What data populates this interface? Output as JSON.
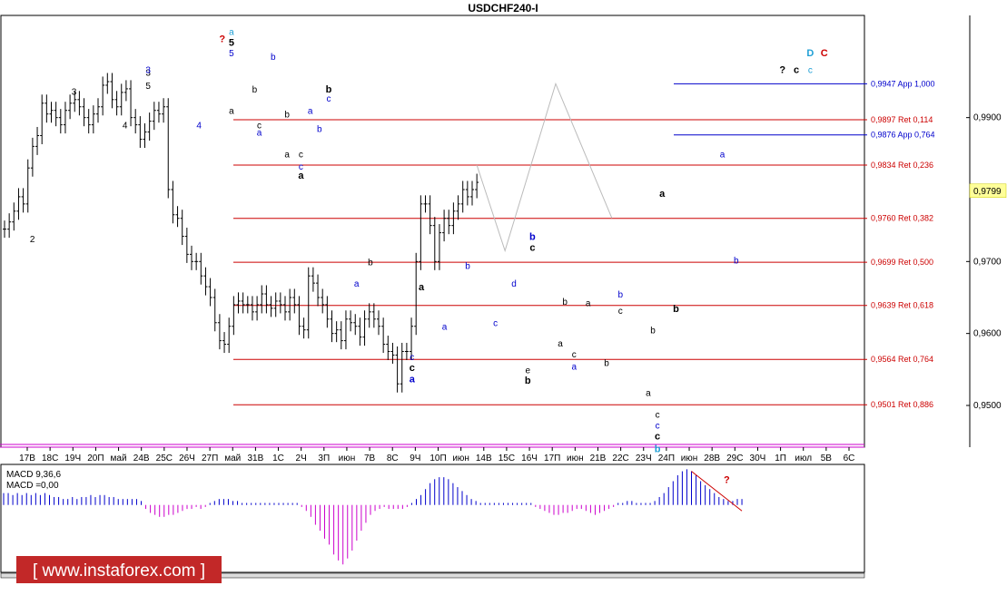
{
  "chart_data": {
    "type": "line",
    "title": "USDCHF240-I",
    "price_ylim": [
      0.9442,
      1.0042
    ],
    "y_ticks": [
      "0,9900",
      "0,9700",
      "0,9600",
      "0,9500"
    ],
    "x_ticks": [
      "17В",
      "18С",
      "19Ч",
      "20П",
      "май",
      "24В",
      "25С",
      "26Ч",
      "27П",
      "май",
      "31В",
      "1С",
      "2Ч",
      "3П",
      "июн",
      "7В",
      "8С",
      "9Ч",
      "10П",
      "июн",
      "14В",
      "15С",
      "16Ч",
      "17П",
      "июн",
      "21В",
      "22С",
      "23Ч",
      "24П",
      "июн",
      "28В",
      "29С",
      "30Ч",
      "1П",
      "июл",
      "5В",
      "6С"
    ],
    "current_price": 0.9799,
    "current_price_label": "0,9799",
    "price_points": [
      [
        0,
        0.9745
      ],
      [
        1,
        0.9755
      ],
      [
        2,
        0.977
      ],
      [
        3,
        0.979
      ],
      [
        4,
        0.978
      ],
      [
        5,
        0.983
      ],
      [
        6,
        0.986
      ],
      [
        7,
        0.9875
      ],
      [
        8,
        0.992
      ],
      [
        9,
        0.9905
      ],
      [
        10,
        0.991
      ],
      [
        11,
        0.99
      ],
      [
        12,
        0.989
      ],
      [
        13,
        0.991
      ],
      [
        14,
        0.992
      ],
      [
        15,
        0.9925
      ],
      [
        16,
        0.9915
      ],
      [
        17,
        0.99
      ],
      [
        18,
        0.989
      ],
      [
        19,
        0.9905
      ],
      [
        20,
        0.9915
      ],
      [
        21,
        0.9945
      ],
      [
        22,
        0.995
      ],
      [
        23,
        0.9925
      ],
      [
        24,
        0.9915
      ],
      [
        25,
        0.9935
      ],
      [
        26,
        0.994
      ],
      [
        27,
        0.99
      ],
      [
        28,
        0.989
      ],
      [
        29,
        0.987
      ],
      [
        30,
        0.988
      ],
      [
        31,
        0.9895
      ],
      [
        32,
        0.991
      ],
      [
        33,
        0.9905
      ],
      [
        34,
        0.9915
      ],
      [
        35,
        0.98
      ],
      [
        36,
        0.9765
      ],
      [
        37,
        0.976
      ],
      [
        38,
        0.9735
      ],
      [
        39,
        0.971
      ],
      [
        40,
        0.97
      ],
      [
        41,
        0.97
      ],
      [
        42,
        0.968
      ],
      [
        43,
        0.9665
      ],
      [
        44,
        0.965
      ],
      [
        45,
        0.9615
      ],
      [
        46,
        0.959
      ],
      [
        47,
        0.9585
      ],
      [
        48,
        0.961
      ],
      [
        49,
        0.964
      ],
      [
        50,
        0.9645
      ],
      [
        51,
        0.964
      ],
      [
        52,
        0.964
      ],
      [
        53,
        0.963
      ],
      [
        54,
        0.964
      ],
      [
        55,
        0.9655
      ],
      [
        56,
        0.964
      ],
      [
        57,
        0.9635
      ],
      [
        58,
        0.9645
      ],
      [
        59,
        0.964
      ],
      [
        60,
        0.963
      ],
      [
        61,
        0.965
      ],
      [
        62,
        0.964
      ],
      [
        63,
        0.961
      ],
      [
        64,
        0.9605
      ],
      [
        65,
        0.968
      ],
      [
        66,
        0.967
      ],
      [
        67,
        0.965
      ],
      [
        68,
        0.964
      ],
      [
        69,
        0.962
      ],
      [
        70,
        0.96
      ],
      [
        71,
        0.9605
      ],
      [
        72,
        0.959
      ],
      [
        73,
        0.962
      ],
      [
        74,
        0.9615
      ],
      [
        75,
        0.961
      ],
      [
        76,
        0.9595
      ],
      [
        77,
        0.962
      ],
      [
        78,
        0.963
      ],
      [
        79,
        0.962
      ],
      [
        80,
        0.961
      ],
      [
        81,
        0.9585
      ],
      [
        82,
        0.9575
      ],
      [
        83,
        0.957
      ],
      [
        84,
        0.953
      ],
      [
        85,
        0.9575
      ],
      [
        86,
        0.9575
      ],
      [
        87,
        0.961
      ],
      [
        88,
        0.97
      ],
      [
        89,
        0.978
      ],
      [
        90,
        0.978
      ],
      [
        91,
        0.975
      ],
      [
        92,
        0.97
      ],
      [
        93,
        0.974
      ],
      [
        94,
        0.976
      ],
      [
        95,
        0.975
      ],
      [
        96,
        0.977
      ],
      [
        97,
        0.978
      ],
      [
        98,
        0.98
      ],
      [
        99,
        0.979
      ],
      [
        100,
        0.98
      ],
      [
        101,
        0.981
      ]
    ],
    "levels": [
      {
        "label": "0,9947 App 1,000",
        "value": 0.9947,
        "color": "#0000cc"
      },
      {
        "label": "0,9897 Ret 0,114",
        "value": 0.9897,
        "color": "#cc0000"
      },
      {
        "label": "0,9876 App 0,764",
        "value": 0.9876,
        "color": "#0000cc"
      },
      {
        "label": "0,9834 Ret 0,236",
        "value": 0.9834,
        "color": "#cc0000"
      },
      {
        "label": "0,9760 Ret 0,382",
        "value": 0.976,
        "color": "#cc0000"
      },
      {
        "label": "0,9699 Ret 0,500",
        "value": 0.9699,
        "color": "#cc0000"
      },
      {
        "label": "0,9639 Ret 0,618",
        "value": 0.9639,
        "color": "#cc0000"
      },
      {
        "label": "0,9564 Ret 0,764",
        "value": 0.9564,
        "color": "#cc0000"
      },
      {
        "label": "0,9501 Ret 0,886",
        "value": 0.9501,
        "color": "#cc0000"
      }
    ],
    "forecast_path": [
      [
        101,
        0.9834
      ],
      [
        106,
        0.9715
      ],
      [
        115,
        0.9947
      ],
      [
        125,
        0.976
      ]
    ],
    "wave_labels": [
      {
        "t": "2",
        "x": 6,
        "y": 0.9727,
        "c": "#000",
        "b": false
      },
      {
        "t": "3",
        "x": 15,
        "y": 0.9932,
        "c": "#000",
        "b": false
      },
      {
        "t": "4",
        "x": 26,
        "y": 0.9885,
        "c": "#000",
        "b": false
      },
      {
        "t": "3",
        "x": 31,
        "y": 0.9958,
        "c": "#000",
        "b": false
      },
      {
        "t": "5",
        "x": 31,
        "y": 0.994,
        "c": "#000",
        "b": false
      },
      {
        "t": "3",
        "x": 31,
        "y": 0.9962,
        "c": "#0000cc",
        "b": false
      },
      {
        "t": "4",
        "x": 42,
        "y": 0.9885,
        "c": "#0000cc",
        "b": false
      },
      {
        "t": "?",
        "x": 47,
        "y": 1.0005,
        "c": "#cc0000",
        "b": true
      },
      {
        "t": "a",
        "x": 49,
        "y": 1.0015,
        "c": "#1f9fd5",
        "b": false
      },
      {
        "t": "5",
        "x": 49,
        "y": 1.0,
        "c": "#000",
        "b": true
      },
      {
        "t": "5",
        "x": 49,
        "y": 0.9985,
        "c": "#0000cc",
        "b": false
      },
      {
        "t": "a",
        "x": 49,
        "y": 0.9905,
        "c": "#000",
        "b": false
      },
      {
        "t": "b",
        "x": 54,
        "y": 0.9935,
        "c": "#000",
        "b": false
      },
      {
        "t": "b",
        "x": 58,
        "y": 0.998,
        "c": "#0000cc",
        "b": false
      },
      {
        "t": "c",
        "x": 55,
        "y": 0.9885,
        "c": "#000",
        "b": false
      },
      {
        "t": "a",
        "x": 55,
        "y": 0.9875,
        "c": "#0000cc",
        "b": false
      },
      {
        "t": "b",
        "x": 61,
        "y": 0.99,
        "c": "#000",
        "b": false
      },
      {
        "t": "a",
        "x": 61,
        "y": 0.9845,
        "c": "#000",
        "b": false
      },
      {
        "t": "c",
        "x": 64,
        "y": 0.9845,
        "c": "#000",
        "b": false
      },
      {
        "t": "c",
        "x": 64,
        "y": 0.9828,
        "c": "#0000cc",
        "b": false
      },
      {
        "t": "a",
        "x": 64,
        "y": 0.9815,
        "c": "#000",
        "b": true
      },
      {
        "t": "a",
        "x": 66,
        "y": 0.9905,
        "c": "#0000cc",
        "b": false
      },
      {
        "t": "b",
        "x": 68,
        "y": 0.988,
        "c": "#0000cc",
        "b": false
      },
      {
        "t": "b",
        "x": 70,
        "y": 0.9935,
        "c": "#000",
        "b": true
      },
      {
        "t": "c",
        "x": 70,
        "y": 0.9922,
        "c": "#0000cc",
        "b": false
      }
    ],
    "wave_labels_2": [
      {
        "t": "b",
        "x": 79,
        "y": 0.9695,
        "c": "#000",
        "b": false
      },
      {
        "t": "a",
        "x": 76,
        "y": 0.9665,
        "c": "#0000cc",
        "b": false
      },
      {
        "t": "c",
        "x": 88,
        "y": 0.9563,
        "c": "#0000cc",
        "b": false
      },
      {
        "t": "c",
        "x": 88,
        "y": 0.9548,
        "c": "#000",
        "b": true
      },
      {
        "t": "a",
        "x": 88,
        "y": 0.9532,
        "c": "#0000cc",
        "b": true
      },
      {
        "t": "a",
        "x": 90,
        "y": 0.966,
        "c": "#000",
        "b": true
      },
      {
        "t": "a",
        "x": 95,
        "y": 0.9605,
        "c": "#0000cc",
        "b": false
      },
      {
        "t": "b",
        "x": 100,
        "y": 0.969,
        "c": "#0000cc",
        "b": false
      },
      {
        "t": "c",
        "x": 106,
        "y": 0.961,
        "c": "#0000cc",
        "b": false
      },
      {
        "t": "d",
        "x": 110,
        "y": 0.9665,
        "c": "#0000cc",
        "b": false
      },
      {
        "t": "b",
        "x": 114,
        "y": 0.973,
        "c": "#0000cc",
        "b": true
      },
      {
        "t": "c",
        "x": 114,
        "y": 0.9715,
        "c": "#000",
        "b": true
      },
      {
        "t": "e",
        "x": 113,
        "y": 0.9545,
        "c": "#000",
        "b": false
      },
      {
        "t": "b",
        "x": 113,
        "y": 0.953,
        "c": "#000",
        "b": true
      },
      {
        "t": "b",
        "x": 121,
        "y": 0.964,
        "c": "#000",
        "b": false
      },
      {
        "t": "a",
        "x": 120,
        "y": 0.9582,
        "c": "#000",
        "b": false
      },
      {
        "t": "c",
        "x": 123,
        "y": 0.9567,
        "c": "#000",
        "b": false
      },
      {
        "t": "a",
        "x": 123,
        "y": 0.955,
        "c": "#0000cc",
        "b": false
      },
      {
        "t": "a",
        "x": 126,
        "y": 0.9638,
        "c": "#000",
        "b": false
      },
      {
        "t": "b",
        "x": 130,
        "y": 0.9555,
        "c": "#000",
        "b": false
      },
      {
        "t": "b",
        "x": 133,
        "y": 0.965,
        "c": "#0000cc",
        "b": false
      },
      {
        "t": "c",
        "x": 133,
        "y": 0.9627,
        "c": "#000",
        "b": false
      },
      {
        "t": "b",
        "x": 140,
        "y": 0.96,
        "c": "#000",
        "b": false
      },
      {
        "t": "a",
        "x": 139,
        "y": 0.9513,
        "c": "#000",
        "b": false
      },
      {
        "t": "c",
        "x": 141,
        "y": 0.9483,
        "c": "#000",
        "b": false
      },
      {
        "t": "c",
        "x": 141,
        "y": 0.9468,
        "c": "#0000cc",
        "b": false
      },
      {
        "t": "c",
        "x": 141,
        "y": 0.9453,
        "c": "#000",
        "b": true
      },
      {
        "t": "b",
        "x": 141,
        "y": 0.9435,
        "c": "#1f9fd5",
        "b": true
      },
      {
        "t": "a",
        "x": 142,
        "y": 0.979,
        "c": "#000",
        "b": true
      },
      {
        "t": "b",
        "x": 145,
        "y": 0.963,
        "c": "#000",
        "b": true
      },
      {
        "t": "a",
        "x": 155,
        "y": 0.9845,
        "c": "#0000cc",
        "b": false
      },
      {
        "t": "b",
        "x": 158,
        "y": 0.9697,
        "c": "#0000cc",
        "b": false
      },
      {
        "t": "?",
        "x": 168,
        "y": 0.9962,
        "c": "#000",
        "b": true
      },
      {
        "t": "c",
        "x": 171,
        "y": 0.9962,
        "c": "#000",
        "b": true
      },
      {
        "t": "c",
        "x": 174,
        "y": 0.9962,
        "c": "#1f9fd5",
        "b": false
      },
      {
        "t": "D",
        "x": 174,
        "y": 0.9985,
        "c": "#1f9fd5",
        "b": true
      },
      {
        "t": "C",
        "x": 177,
        "y": 0.9985,
        "c": "#cc0000",
        "b": true
      }
    ],
    "macd": {
      "label_line1": "MACD 9,36,6",
      "label_line2": "MACD =0,00",
      "ylim": [
        -0.0034,
        0.002
      ],
      "values": [
        0.0006,
        0.0006,
        0.0005,
        0.0006,
        0.0005,
        0.0006,
        0.0005,
        0.0006,
        0.0005,
        0.0006,
        0.0005,
        0.0004,
        0.0004,
        0.0003,
        0.0003,
        0.0004,
        0.0003,
        0.0004,
        0.0004,
        0.0005,
        0.0004,
        0.0005,
        0.0005,
        0.0004,
        0.0004,
        0.0003,
        0.0003,
        0.0003,
        0.0003,
        0.0003,
        0.0002,
        -0.0002,
        -0.0004,
        -0.0005,
        -0.0006,
        -0.0006,
        -0.0005,
        -0.0005,
        -0.0004,
        -0.0003,
        -0.0002,
        -0.0002,
        -0.0001,
        -0.0002,
        -0.0001,
        0.0001,
        0.0002,
        0.0003,
        0.0003,
        0.0003,
        0.0002,
        0.0002,
        0.0001,
        0.0001,
        0.0001,
        0.0001,
        0.0001,
        0.0001,
        0.0001,
        0.0001,
        0.0001,
        0.0001,
        0.0001,
        0.0001,
        0.0001,
        -0.0001,
        -0.0003,
        -0.0006,
        -0.001,
        -0.0013,
        -0.0017,
        -0.002,
        -0.0025,
        -0.0028,
        -0.003,
        -0.0027,
        -0.0023,
        -0.0018,
        -0.0013,
        -0.0009,
        -0.0005,
        -0.0003,
        -0.0002,
        -0.0001,
        -0.0002,
        -0.0002,
        -0.0002,
        -0.0002,
        -0.0001,
        0.0001,
        0.0003,
        0.0005,
        0.0008,
        0.0011,
        0.0013,
        0.0014,
        0.0014,
        0.0013,
        0.0011,
        0.0009,
        0.0007,
        0.0005,
        0.0003,
        0.0002,
        0.0001,
        0.0001,
        0.0001,
        0.0001,
        0.0001,
        0.0001,
        0.0001,
        0.0001,
        0.0001,
        0.0001,
        0.0001,
        0.0001,
        -0.0001,
        -0.0002,
        -0.0003,
        -0.0004,
        -0.0005,
        -0.0005,
        -0.0004,
        -0.0004,
        -0.0003,
        -0.0002,
        -0.0002,
        -0.0003,
        -0.0004,
        -0.0005,
        -0.0004,
        -0.0003,
        -0.0002,
        -0.0001,
        0.0001,
        0.0001,
        0.0002,
        0.0002,
        0.0001,
        0.0001,
        0.0001,
        0.0001,
        0.0002,
        0.0004,
        0.0006,
        0.0009,
        0.0012,
        0.0015,
        0.0017,
        0.0018,
        0.0017,
        0.0015,
        0.0012,
        0.001,
        0.0008,
        0.0006,
        0.0004,
        0.0003,
        0.0002,
        0.0002,
        0.0003,
        0.0003
      ],
      "trend_marker": "?"
    },
    "watermark": "[ www.instaforex.com ]",
    "colors": {
      "bars": "#000000",
      "resistance": "#cc0000",
      "projection": "#0000cc",
      "forecast": "#bbbbbb",
      "macd_pos": "#0000cc",
      "macd_neg": "#cc00cc",
      "price_box": "#ffff99"
    }
  }
}
